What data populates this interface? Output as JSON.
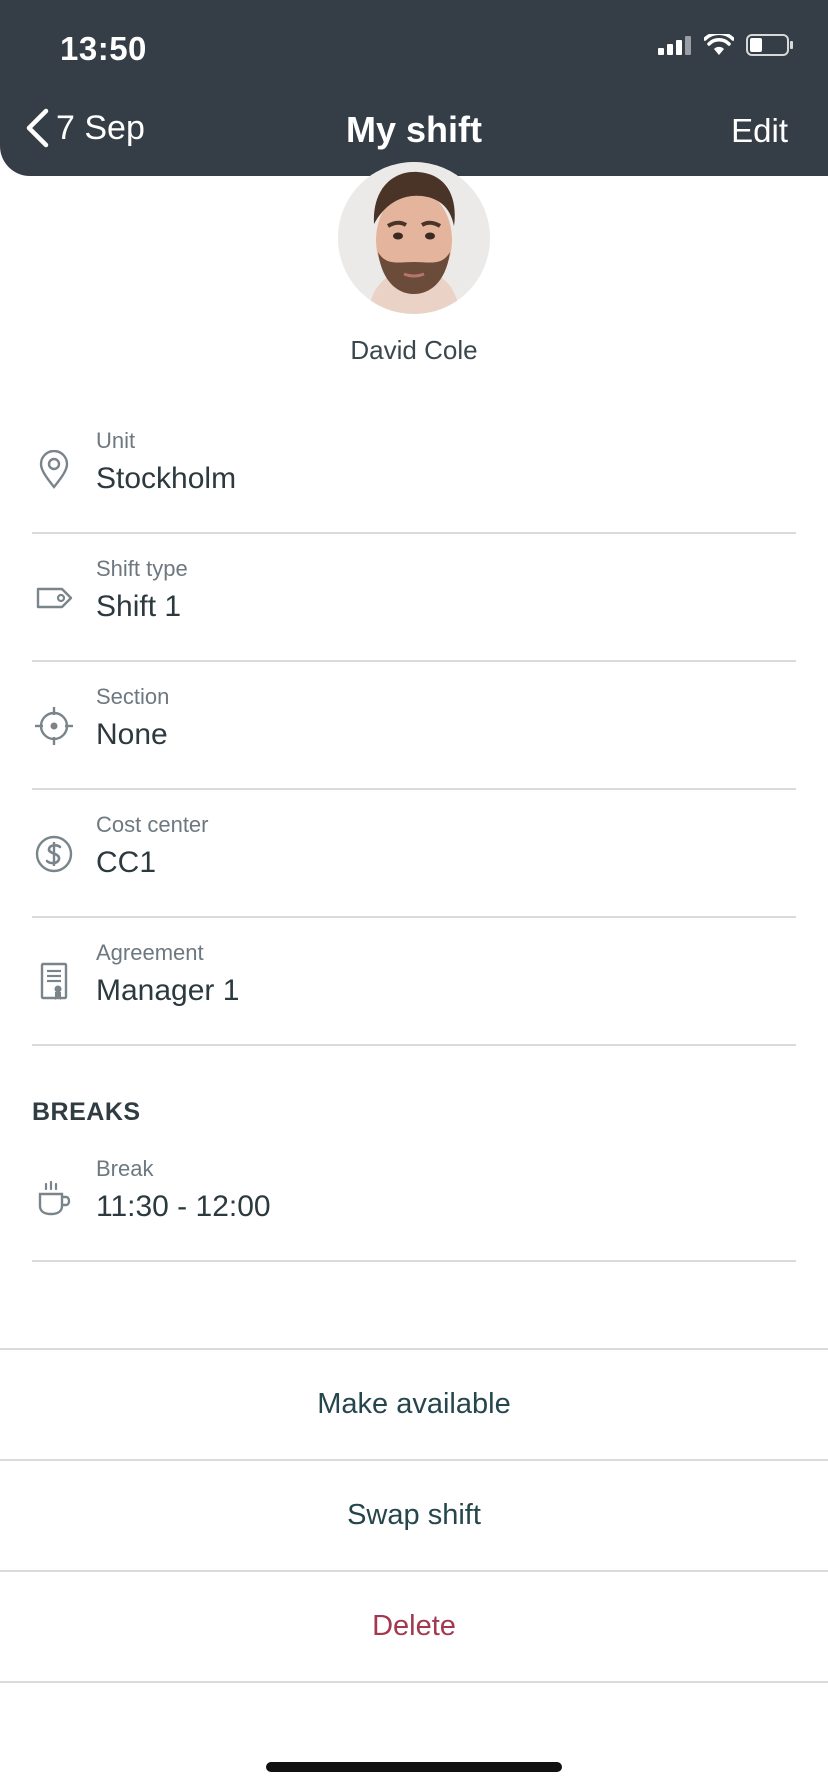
{
  "status_bar": {
    "time": "13:50",
    "icons": [
      "signal-icon",
      "wifi-icon",
      "battery-icon"
    ]
  },
  "nav": {
    "back_label": "7 Sep",
    "title": "My shift",
    "edit_label": "Edit"
  },
  "profile": {
    "name": "David Cole",
    "avatar": "avatar-photo"
  },
  "details": [
    {
      "label": "Unit",
      "value": "Stockholm",
      "icon": "location-pin-icon"
    },
    {
      "label": "Shift type",
      "value": "Shift 1",
      "icon": "tag-icon"
    },
    {
      "label": "Section",
      "value": "None",
      "icon": "crosshair-icon"
    },
    {
      "label": "Cost center",
      "value": "CC1",
      "icon": "dollar-icon"
    },
    {
      "label": "Agreement",
      "value": "Manager 1",
      "icon": "certificate-icon"
    }
  ],
  "breaks": {
    "heading": "BREAKS",
    "items": [
      {
        "label": "Break",
        "value": "11:30 - 12:00",
        "icon": "coffee-cup-icon"
      }
    ]
  },
  "actions": [
    {
      "label": "Make available"
    },
    {
      "label": "Swap shift"
    },
    {
      "label": "Delete"
    }
  ],
  "colors": {
    "header_bg": "#353d46",
    "text_primary": "#2c3a40",
    "action_text": "#24464c",
    "danger": "#a3384f",
    "divider": "#d9dcde"
  }
}
